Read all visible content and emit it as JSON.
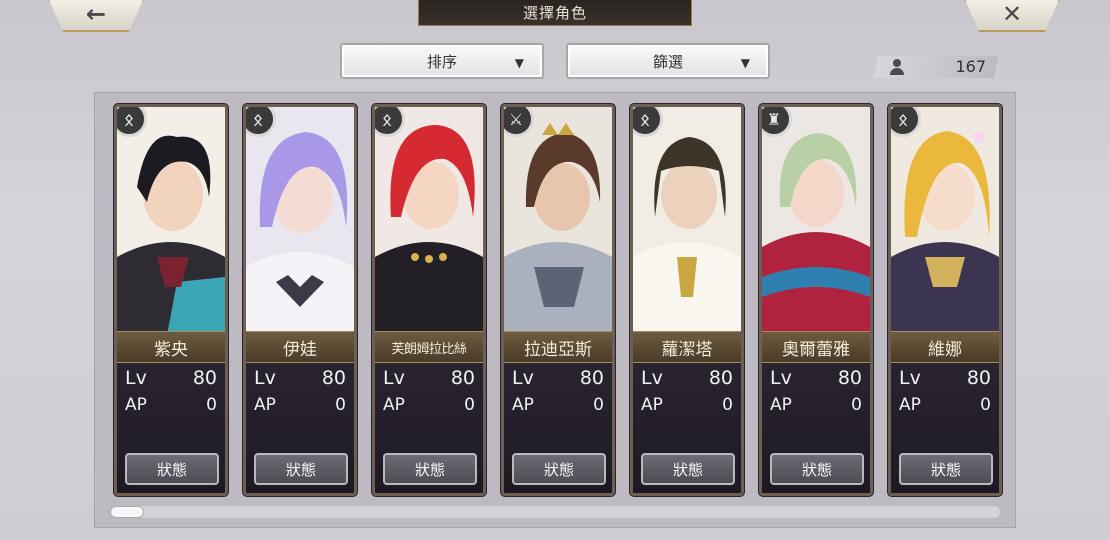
{
  "header": {
    "title": "選擇角色",
    "back_label": "←",
    "close_label": "✕"
  },
  "controls": {
    "sort_label": "排序",
    "filter_label": "篩選",
    "caret": "▼"
  },
  "roster_count": "167",
  "stat_labels": {
    "lv": "Lv",
    "ap": "AP",
    "status": "狀態"
  },
  "characters": [
    {
      "name": "紫央",
      "lv": "80",
      "ap": "0",
      "type_icon": "staff-icon"
    },
    {
      "name": "伊娃",
      "lv": "80",
      "ap": "0",
      "type_icon": "staff-icon"
    },
    {
      "name": "芙朗姆拉比絲",
      "lv": "80",
      "ap": "0",
      "type_icon": "staff-icon"
    },
    {
      "name": "拉迪亞斯",
      "lv": "80",
      "ap": "0",
      "type_icon": "sword-icon"
    },
    {
      "name": "蘿潔塔",
      "lv": "80",
      "ap": "0",
      "type_icon": "staff-icon"
    },
    {
      "name": "奧爾蕾雅",
      "lv": "80",
      "ap": "0",
      "type_icon": "hat-icon"
    },
    {
      "name": "維娜",
      "lv": "80",
      "ap": "0",
      "type_icon": "staff-icon"
    }
  ],
  "colors": {
    "plate_gold": "#a68d5c",
    "card_frame": "#6e5f54",
    "title_bg": "#2a2420"
  }
}
